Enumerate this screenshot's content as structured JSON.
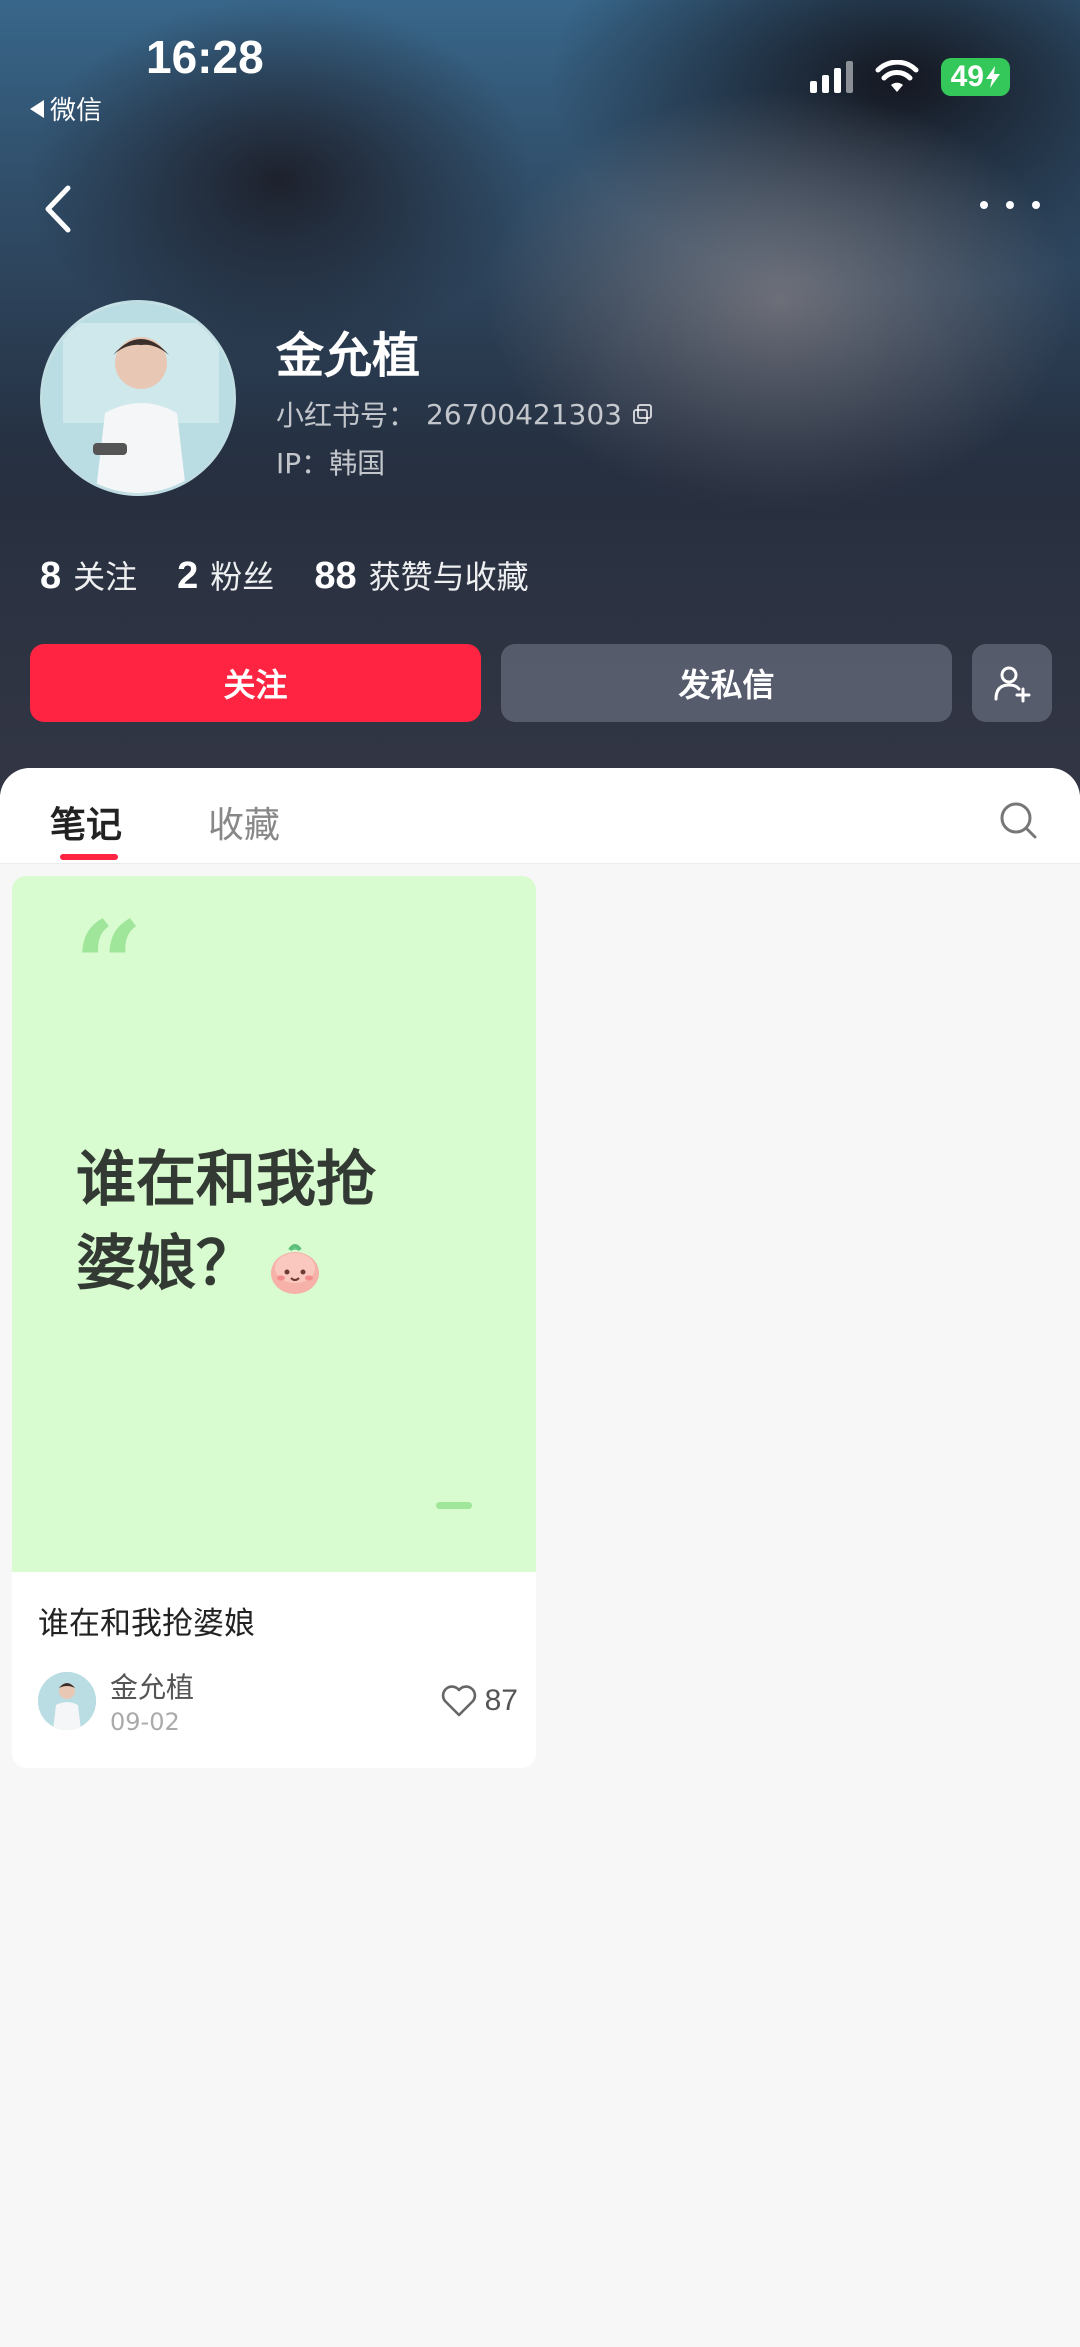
{
  "status_bar": {
    "time": "16:28",
    "back_app": "微信",
    "battery": "49"
  },
  "profile": {
    "name": "金允植",
    "id_label": "小红书号：",
    "id_value": "26700421303",
    "ip": "IP：韩国"
  },
  "stats": [
    {
      "num": "8",
      "label": "关注"
    },
    {
      "num": "2",
      "label": "粉丝"
    },
    {
      "num": "88",
      "label": "获赞与收藏"
    }
  ],
  "buttons": {
    "follow": "关注",
    "message": "发私信"
  },
  "tabs": {
    "notes": "笔记",
    "favorites": "收藏"
  },
  "note": {
    "cover_line1": "谁在和我抢",
    "cover_line2": "婆娘？",
    "title": "谁在和我抢婆娘",
    "author": "金允植",
    "date": "09-02",
    "likes": "87"
  },
  "colors": {
    "accent": "#ff2442",
    "cover_bg": "#d8fbd0",
    "battery": "#34c759"
  }
}
